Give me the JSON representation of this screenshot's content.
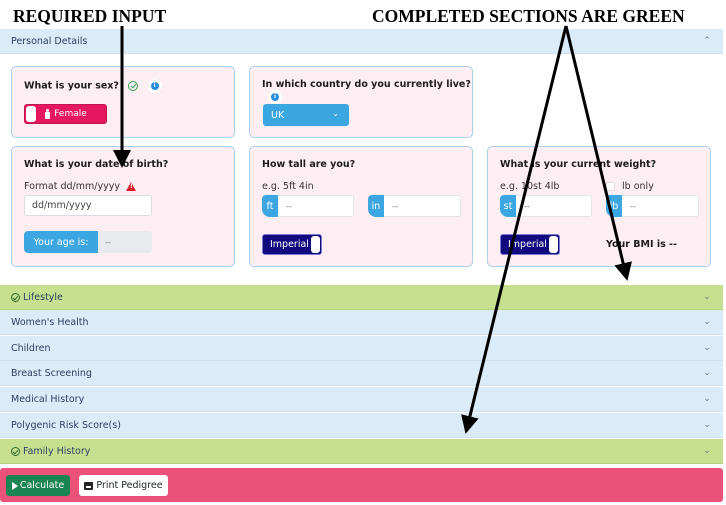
{
  "annotations": {
    "required_input": "REQUIRED INPUT",
    "completed_sections": "COMPLETED SECTIONS ARE GREEN"
  },
  "personal_details": {
    "title": "Personal Details",
    "expanded": true,
    "sex": {
      "question": "What is your sex?",
      "completed": true,
      "value": "Female"
    },
    "country": {
      "question": "In which country do you currently live?",
      "value": "UK"
    },
    "dob": {
      "question": "What is your date of birth?",
      "format_hint": "Format dd/mm/yyyy",
      "required_warning": true,
      "placeholder": "dd/mm/yyyy",
      "age_label": "Your age is:",
      "age_value": "--"
    },
    "height": {
      "question": "How tall are you?",
      "example": "e.g. 5ft 4in",
      "ft_label": "ft",
      "ft_value": "--",
      "in_label": "in",
      "in_value": "--",
      "unit_toggle": "Imperial"
    },
    "weight": {
      "question": "What is your current weight?",
      "example": "e.g. 10st 4lb",
      "lb_only_label": "lb only",
      "lb_only_checked": false,
      "st_label": "st",
      "st_value": "--",
      "lb_label": "lb",
      "lb_value": "--",
      "unit_toggle": "Imperial",
      "bmi_text": "Your BMI is --"
    }
  },
  "sections": [
    {
      "label": "Lifestyle",
      "completed": true
    },
    {
      "label": "Women's Health",
      "completed": false
    },
    {
      "label": "Children",
      "completed": false
    },
    {
      "label": "Breast Screening",
      "completed": false
    },
    {
      "label": "Medical History",
      "completed": false
    },
    {
      "label": "Polygenic Risk Score(s)",
      "completed": false
    },
    {
      "label": "Family History",
      "completed": true
    }
  ],
  "footer": {
    "calculate_label": "Calculate",
    "print_label": "Print Pedigree"
  },
  "colors": {
    "completed_section": "#c7e08f",
    "incomplete_section": "#dcebf8",
    "card_bg": "#fdeef3",
    "accent_blue": "#3ba6e0",
    "female_toggle": "#e5175e",
    "imperial_toggle": "#100a7e",
    "footer_bg": "#eb5179",
    "calculate_btn": "#1a8553",
    "warning": "#d9202a"
  }
}
